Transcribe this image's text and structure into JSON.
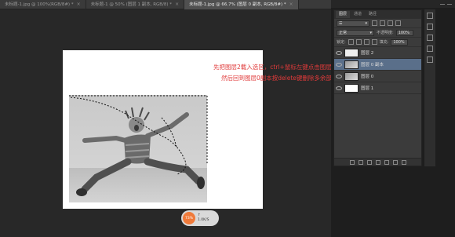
{
  "tabs": [
    {
      "label": "未标题-1.jpg @ 100%(RGB/8#) *",
      "active": false
    },
    {
      "label": "未标题-1 @ 50% (图层 1 副本, RGB/8) *",
      "active": false
    },
    {
      "label": "未标题-1.jpg @ 66.7% (图层 0 副本, RGB/8#) *",
      "active": true
    }
  ],
  "notes": {
    "line1": "先把图层2载入选区，ctrl+鼠标左键点击图层",
    "line2": "然后回到图层0副本按delete键删除多余部分"
  },
  "status": {
    "percent": "73%",
    "line1": "↑",
    "line2": "1.0K/S"
  },
  "layers_panel": {
    "tabs": [
      "图层",
      "通道",
      "路径"
    ],
    "blend_mode": "正常",
    "opacity_label": "不透明度:",
    "opacity_value": "100%",
    "lock_label": "锁定:",
    "fill_label": "填充:",
    "fill_value": "100%",
    "layers": [
      {
        "name": "图层 2",
        "selected": false
      },
      {
        "name": "图层 0 副本",
        "selected": true
      },
      {
        "name": "图层 0",
        "selected": false
      },
      {
        "name": "图层 1",
        "selected": false
      }
    ]
  },
  "colors": {
    "accent_selected": "#5a6f8a",
    "note_red": "#e03a3a"
  }
}
